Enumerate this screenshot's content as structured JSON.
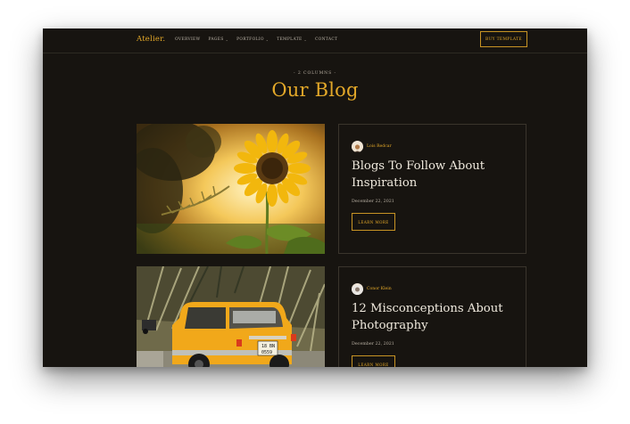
{
  "header": {
    "logo": "Atelier.",
    "menu": [
      {
        "label": "OVERVIEW",
        "dropdown": false
      },
      {
        "label": "PAGES",
        "dropdown": true
      },
      {
        "label": "PORTFOLIO",
        "dropdown": true
      },
      {
        "label": "TEMPLATE",
        "dropdown": true
      },
      {
        "label": "CONTACT",
        "dropdown": false
      }
    ],
    "buy_label": "BUY TEMPLATE"
  },
  "section": {
    "kicker": "- 2 COLUMNS -",
    "title": "Our Blog"
  },
  "posts": [
    {
      "author": "Lois Redcar",
      "title": "Blogs To Follow About Inspiration",
      "date": "December 22, 2021",
      "button": "LEARN MORE",
      "image_icon": "sunflower-photo"
    },
    {
      "author": "Conor Klein",
      "title": "12 Misconceptions About Photography",
      "date": "December 22, 2021",
      "button": "LEARN MORE",
      "image_icon": "yellow-car-photo"
    }
  ],
  "colors": {
    "background": "#171410",
    "accent": "#e3a829",
    "border": "#3a352c",
    "text": "#efe9dd"
  }
}
